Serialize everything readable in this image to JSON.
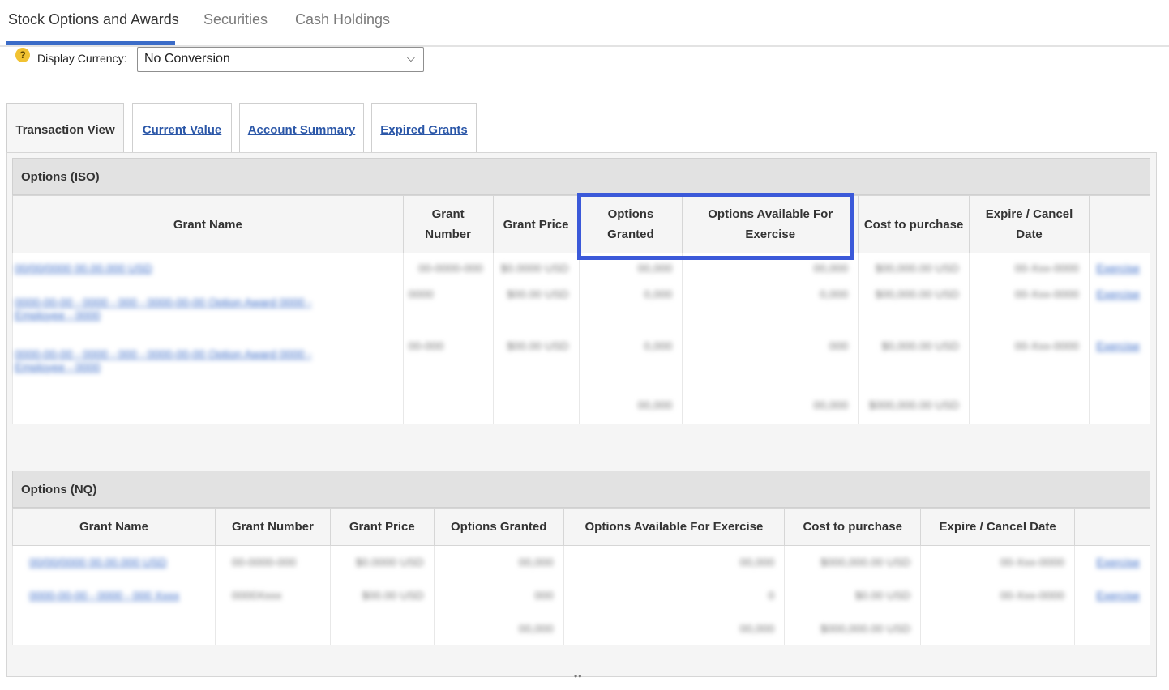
{
  "top_tabs": [
    {
      "label": "Stock Options and Awards",
      "active": true
    },
    {
      "label": "Securities",
      "active": false
    },
    {
      "label": "Cash Holdings",
      "active": false
    }
  ],
  "currency": {
    "label": "Display Currency:",
    "selected": "No Conversion",
    "help_icon": "question-icon"
  },
  "view_tabs": [
    {
      "label": "Transaction View",
      "active": true
    },
    {
      "label": "Current Value",
      "active": false
    },
    {
      "label": "Account Summary",
      "active": false
    },
    {
      "label": "Expired Grants",
      "active": false
    }
  ],
  "iso": {
    "title": "Options (ISO)",
    "headers": [
      "Grant Name",
      "Grant Number",
      "Grant Price",
      "Options Granted",
      "Options Available For Exercise",
      "Cost to purchase",
      "Expire / Cancel Date",
      ""
    ],
    "rows": [
      {
        "name": "00/00/0000 00.00.000 USD",
        "number": "00-0000-000",
        "price": "$0.0000 USD",
        "granted": "00,000",
        "available": "00,000",
        "cost": "$00,000.00 USD",
        "expire": "00-Xxx-0000",
        "action": "Exercise"
      },
      {
        "name": "0000-00-00 - 0000 - 000 - 0000-00-00 Option Award 0000 - Employee - 0000",
        "number": "0000",
        "price": "$00.00 USD",
        "granted": "0,000",
        "available": "0,000",
        "cost": "$00,000.00 USD",
        "expire": "00-Xxx-0000",
        "action": "Exercise"
      },
      {
        "name": "0000-00-00 - 0000 - 000 - 0000-00-00 Option Award 0000 - Employee - 0000",
        "number": "00-000",
        "price": "$00.00 USD",
        "granted": "0,000",
        "available": "000",
        "cost": "$0,000.00 USD",
        "expire": "00-Xxx-0000",
        "action": "Exercise"
      }
    ],
    "totals": {
      "granted": "00,000",
      "available": "00,000",
      "cost": "$000,000.00 USD"
    }
  },
  "nq": {
    "title": "Options (NQ)",
    "headers": [
      "Grant Name",
      "Grant Number",
      "Grant Price",
      "Options Granted",
      "Options Available For Exercise",
      "Cost to purchase",
      "Expire / Cancel Date",
      ""
    ],
    "rows": [
      {
        "name": "00/00/0000 00.00.000 USD",
        "number": "00-0000-000",
        "price": "$0.0000 USD",
        "granted": "00,000",
        "available": "00,000",
        "cost": "$000,000.00 USD",
        "expire": "00-Xxx-0000",
        "action": "Exercise"
      },
      {
        "name": "0000-00-00 - 0000 - 000 Xxxx",
        "number": "0000Xxxx",
        "price": "$00.00 USD",
        "granted": "000",
        "available": "0",
        "cost": "$0.00 USD",
        "expire": "00-Xxx-0000",
        "action": "Exercise"
      }
    ],
    "totals": {
      "granted": "00,000",
      "available": "00,000",
      "cost": "$000,000.00 USD"
    }
  },
  "colors": {
    "accent": "#3b6cc8",
    "highlight_border": "#3b59d9",
    "link": "#2b57a8"
  }
}
